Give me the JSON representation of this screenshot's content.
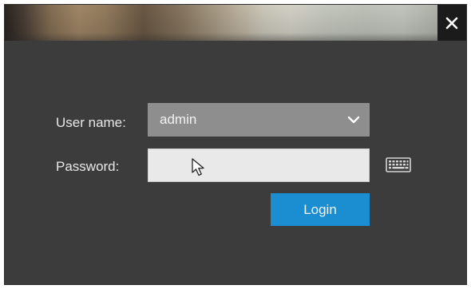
{
  "dialog": {
    "close_icon": "close-icon"
  },
  "form": {
    "username_label": "User name:",
    "username_value": "admin",
    "password_label": "Password:",
    "password_value": "",
    "keyboard_icon": "keyboard-icon",
    "login_label": "Login"
  },
  "colors": {
    "dialog_bg": "#3c3c3c",
    "select_bg": "#8e8e8e",
    "input_bg": "#e9e9e9",
    "accent": "#1a8ed0",
    "close_bg": "#1b1b1b"
  }
}
